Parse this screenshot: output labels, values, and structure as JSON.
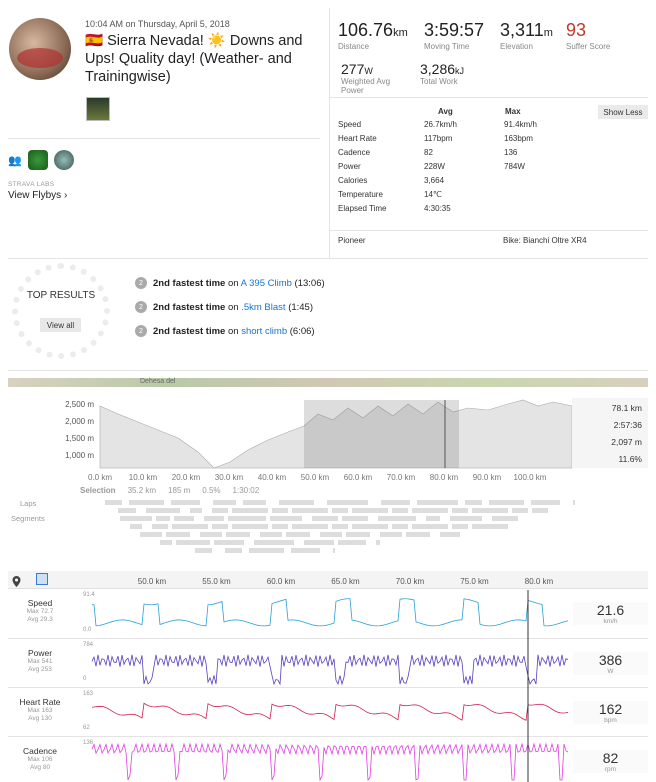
{
  "header": {
    "date": "10:04 AM on Thursday, April 5, 2018",
    "title": "🇪🇸 Sierra Nevada! ☀️ Downs and Ups! Quality day! (Weather- and Trainingwise)"
  },
  "social": {
    "strava_labs": "STRAVA LABS",
    "view_flybys": "View Flybys ›"
  },
  "stats": {
    "distance": {
      "value": "106.76",
      "unit": "km",
      "label": "Distance"
    },
    "moving_time": {
      "value": "3:59:57",
      "label": "Moving Time"
    },
    "elevation": {
      "value": "3,311",
      "unit": "m",
      "label": "Elevation"
    },
    "suffer": {
      "value": "93",
      "label": "Suffer Score"
    },
    "power": {
      "value": "277",
      "unit": "W",
      "label": "Weighted Avg Power"
    },
    "work": {
      "value": "3,286",
      "unit": "kJ",
      "label": "Total Work"
    }
  },
  "table": {
    "col_avg": "Avg",
    "col_max": "Max",
    "show_less": "Show Less",
    "rows": [
      {
        "label": "Speed",
        "avg": "26.7km/h",
        "max": "91.4km/h"
      },
      {
        "label": "Heart Rate",
        "avg": "117bpm",
        "max": "163bpm"
      },
      {
        "label": "Cadence",
        "avg": "82",
        "max": "136"
      },
      {
        "label": "Power",
        "avg": "228W",
        "max": "784W"
      },
      {
        "label": "Calories",
        "avg": "3,664",
        "max": ""
      },
      {
        "label": "Temperature",
        "avg": "14℃",
        "max": ""
      },
      {
        "label": "Elapsed Time",
        "avg": "4:30:35",
        "max": ""
      }
    ],
    "device": "Pioneer",
    "bike": "Bike: Bianchi Oltre XR4"
  },
  "top_results": {
    "title": "TOP RESULTS",
    "view_all": "View all",
    "items": [
      {
        "medal": "2",
        "bold": "2nd fastest time",
        "on": "on",
        "segment": "A 395 Climb",
        "time": "(13:06)"
      },
      {
        "medal": "2",
        "bold": "2nd fastest time",
        "on": "on",
        "segment": ".5km Blast",
        "time": "(1:45)"
      },
      {
        "medal": "2",
        "bold": "2nd fastest time",
        "on": "on",
        "segment": "short climb",
        "time": "(6:06)"
      }
    ]
  },
  "map": {
    "label": "Dehesa del"
  },
  "elevation_chart": {
    "y_ticks": [
      "2,500 m",
      "2,000 m",
      "1,500 m",
      "1,000 m"
    ],
    "x_ticks": [
      "0.0 km",
      "10.0 km",
      "20.0 km",
      "30.0 km",
      "40.0 km",
      "50.0 km",
      "60.0 km",
      "70.0 km",
      "80.0 km",
      "90.0 km",
      "100.0 km"
    ],
    "side": [
      "78.1 km",
      "2:57:36",
      "2,097 m",
      "11.6%"
    ],
    "selection": {
      "label": "Selection",
      "dist": "35.2 km",
      "elev": "185 m",
      "grade": "0.5%",
      "time": "1:30:02"
    },
    "laps": "Laps",
    "segments": "Segments"
  },
  "analysis": {
    "x_ticks": [
      "50.0 km",
      "55.0 km",
      "60.0 km",
      "65.0 km",
      "70.0 km",
      "75.0 km",
      "80.0 km"
    ],
    "rows": [
      {
        "name": "Speed",
        "max": "Max 72.7",
        "avg": "Avg 29.3",
        "top": "91.4",
        "bottom": "0.0",
        "value": "21.6",
        "unit": "km/h",
        "color": "#2a9fd6"
      },
      {
        "name": "Power",
        "max": "Max 541",
        "avg": "Avg 253",
        "top": "784",
        "bottom": "0",
        "value": "386",
        "unit": "W",
        "color": "#5a3fc0"
      },
      {
        "name": "Heart Rate",
        "max": "Max 163",
        "avg": "Avg 130",
        "top": "163",
        "bottom": "62",
        "value": "162",
        "unit": "bpm",
        "color": "#d02050"
      },
      {
        "name": "Cadence",
        "max": "Max 106",
        "avg": "Avg 80",
        "top": "136",
        "bottom": "",
        "value": "82",
        "unit": "rpm",
        "color": "#e040e0"
      }
    ]
  }
}
